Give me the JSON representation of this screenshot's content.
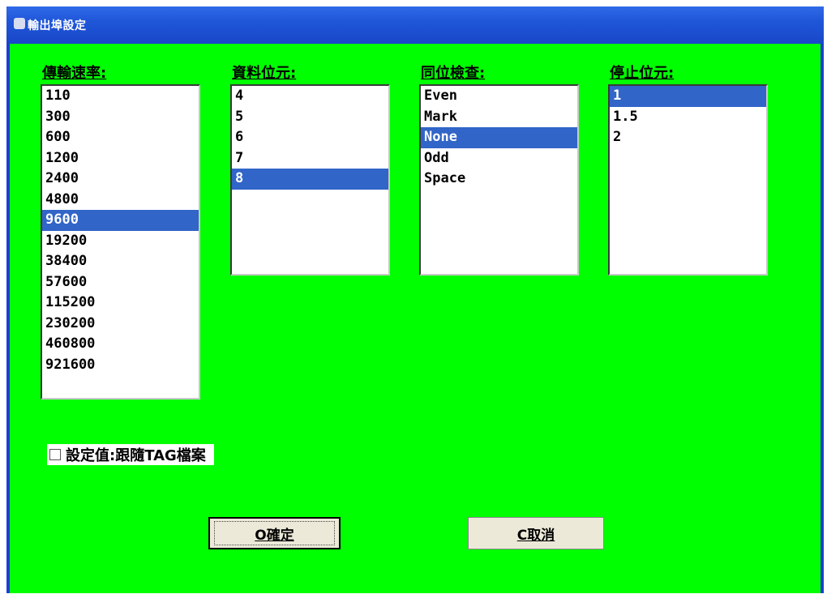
{
  "window": {
    "title": "輸出埠設定"
  },
  "baud_rate": {
    "label": "傳輸速率:",
    "options": [
      "110",
      "300",
      "600",
      "1200",
      "2400",
      "4800",
      "9600",
      "19200",
      "38400",
      "57600",
      "115200",
      "230200",
      "460800",
      "921600"
    ],
    "selected": "9600"
  },
  "data_bits": {
    "label": "資料位元:",
    "options": [
      "4",
      "5",
      "6",
      "7",
      "8"
    ],
    "selected": "8"
  },
  "parity": {
    "label": "同位檢查:",
    "options": [
      "Even",
      "Mark",
      "None",
      "Odd",
      "Space"
    ],
    "selected": "None"
  },
  "stop_bits": {
    "label": "停止位元:",
    "options": [
      "1",
      "1.5",
      "2"
    ],
    "selected": "1"
  },
  "checkbox": {
    "label": "設定值:跟隨TAG檔案",
    "checked": false
  },
  "buttons": {
    "ok": "O確定",
    "cancel": "C取消"
  },
  "colors": {
    "client_bg": "#00ff00",
    "selection": "#3165c8",
    "titlebar": "#1f56d8"
  }
}
